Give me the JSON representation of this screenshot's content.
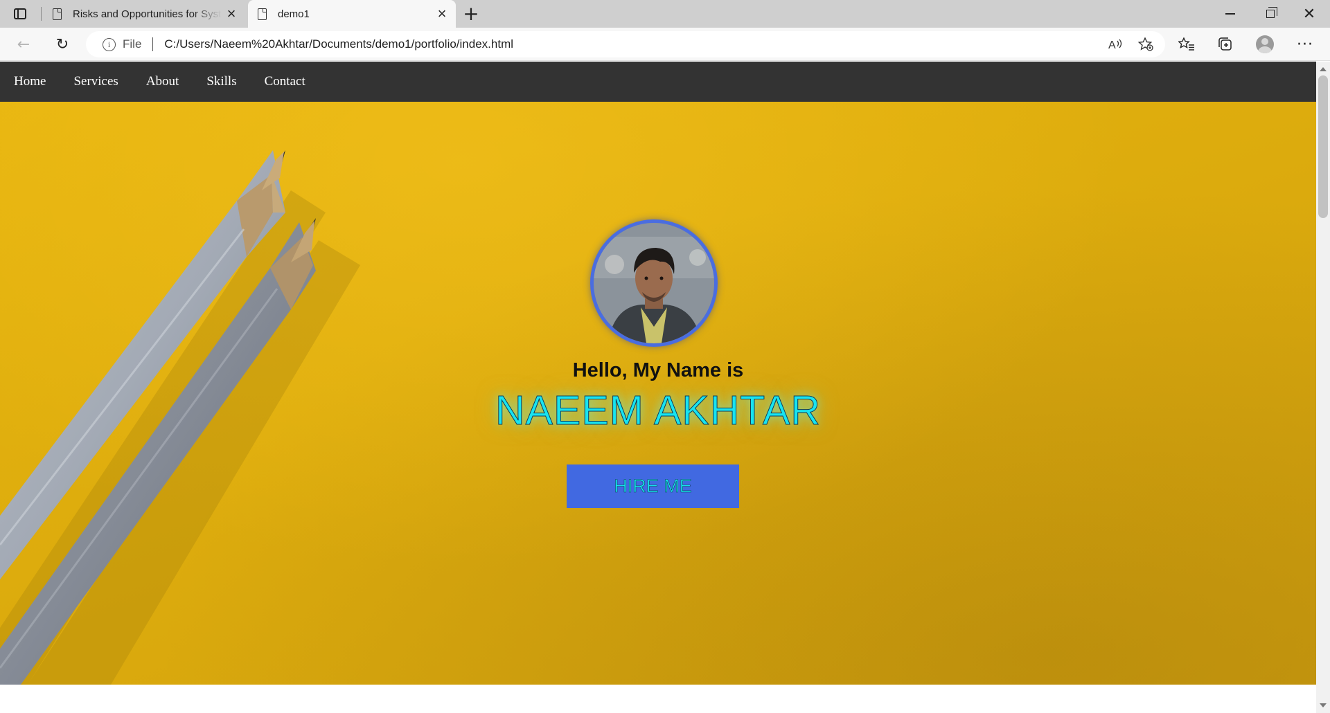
{
  "browser": {
    "tabs": [
      {
        "title": "Risks and Opportunities for Systems",
        "active": false
      },
      {
        "title": "demo1",
        "active": true
      }
    ],
    "address": {
      "scheme_label": "File",
      "url": "C:/Users/Naeem%20Akhtar/Documents/demo1/portfolio/index.html"
    }
  },
  "site": {
    "nav": [
      "Home",
      "Services",
      "About",
      "Skills",
      "Contact"
    ],
    "hero": {
      "greeting": "Hello, My Name is",
      "name": "NAEEM AKHTAR",
      "cta": "HIRE ME"
    }
  },
  "colors": {
    "nav_bg": "#333333",
    "hero_bg": "#ddac0d",
    "button_bg": "#4169e1",
    "name_text": "#18e4f0",
    "avatar_ring": "#4a6de0"
  }
}
